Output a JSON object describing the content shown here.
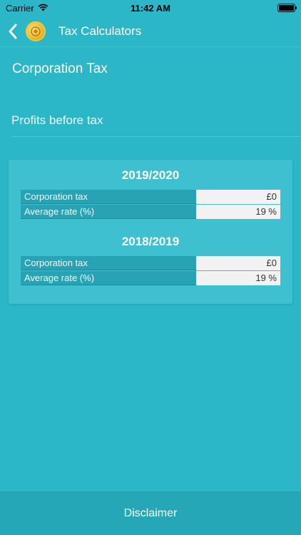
{
  "status": {
    "carrier": "Carrier",
    "time": "11:42 AM"
  },
  "nav": {
    "title": "Tax Calculators"
  },
  "page": {
    "title": "Corporation Tax"
  },
  "input": {
    "placeholder": "Profits before tax",
    "value": ""
  },
  "results": [
    {
      "year": "2019/2020",
      "rows": [
        {
          "label": "Corporation tax",
          "value": "£0"
        },
        {
          "label": "Average rate (%)",
          "value": "19 %"
        }
      ]
    },
    {
      "year": "2018/2019",
      "rows": [
        {
          "label": "Corporation tax",
          "value": "£0"
        },
        {
          "label": "Average rate (%)",
          "value": "19 %"
        }
      ]
    }
  ],
  "footer": {
    "disclaimer_label": "Disclaimer"
  },
  "colors": {
    "background": "#2bb7c8",
    "card": "#3ec0d0",
    "label_cell": "#27a3b5",
    "value_cell": "#f2f2f2",
    "footer": "#25a7b7"
  },
  "icons": {
    "back": "chevron-left-icon",
    "logo": "gold-coin-logo",
    "wifi": "wifi-icon",
    "battery": "battery-icon"
  }
}
